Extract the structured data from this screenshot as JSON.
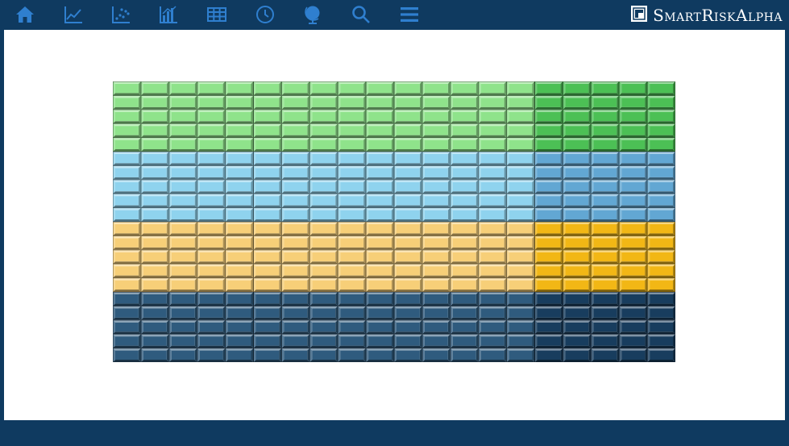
{
  "nav": {
    "icons": [
      "home-icon",
      "line-chart-icon",
      "scatter-plot-icon",
      "bar-chart-icon",
      "table-icon",
      "clock-icon",
      "globe-icon",
      "search-icon",
      "menu-icon"
    ],
    "icon_color": "#2f7fcf"
  },
  "brand": {
    "name": "SmartRiskAlpha",
    "logo_icon": "brand-logo-icon",
    "text_color": "#ffffff"
  },
  "theme": {
    "bar_color": "#0f3a60",
    "content_background": "#ffffff"
  },
  "grid": {
    "left_columns": 15,
    "right_columns": 5,
    "rows_per_band": 5,
    "bands": [
      {
        "name": "green",
        "left_color": "#8fe38b",
        "right_color": "#4cc055"
      },
      {
        "name": "light-blue",
        "left_color": "#8fd3ee",
        "right_color": "#62a7d3"
      },
      {
        "name": "yellow",
        "left_color": "#f7cf78",
        "right_color": "#f2b715"
      },
      {
        "name": "navy",
        "left_color": "#2f5b7e",
        "right_color": "#183d5e"
      }
    ]
  }
}
